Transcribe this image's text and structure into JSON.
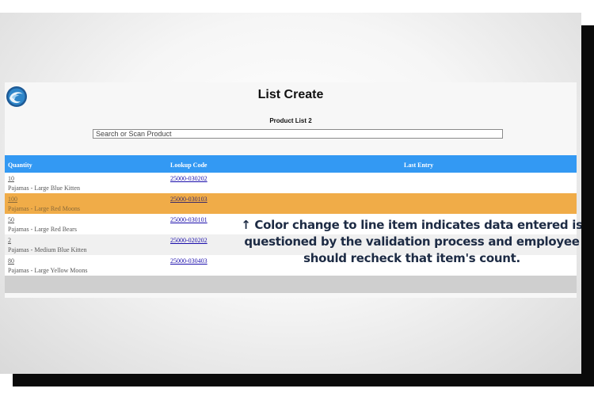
{
  "app": {
    "title": "List Create",
    "list_name": "Product List 2"
  },
  "search": {
    "placeholder": "Search or Scan Product"
  },
  "table": {
    "headers": {
      "quantity": "Quantity",
      "lookup_code": "Lookup Code",
      "last_entry": "Last Entry"
    },
    "rows": [
      {
        "quantity": "10",
        "description": "Pajamas - Large Blue Kitten",
        "lookup_code": "25000-030202",
        "flagged": false
      },
      {
        "quantity": "100",
        "description": "Pajamas - Large Red Moons",
        "lookup_code": "25000-030103",
        "flagged": true
      },
      {
        "quantity": "50",
        "description": "Pajamas - Large Red Bears",
        "lookup_code": "25000-030101",
        "flagged": false
      },
      {
        "quantity": "2",
        "description": "Pajamas - Medium Blue Kitten",
        "lookup_code": "25000-020202",
        "flagged": false
      },
      {
        "quantity": "80",
        "description": "Pajamas - Large Yellow Moons",
        "lookup_code": "25000-030403",
        "flagged": false
      }
    ]
  },
  "annotation": {
    "line1": "↑ Color change to line item indicates data entered is",
    "line2": "questioned by the validation process and employee",
    "line3": "should recheck that item's count."
  },
  "colors": {
    "header_bg": "#3399f3",
    "flagged_row": "#f0ac48",
    "annotation_text": "#1d2b44"
  },
  "icons": {
    "logo": "wave-logo-icon"
  }
}
